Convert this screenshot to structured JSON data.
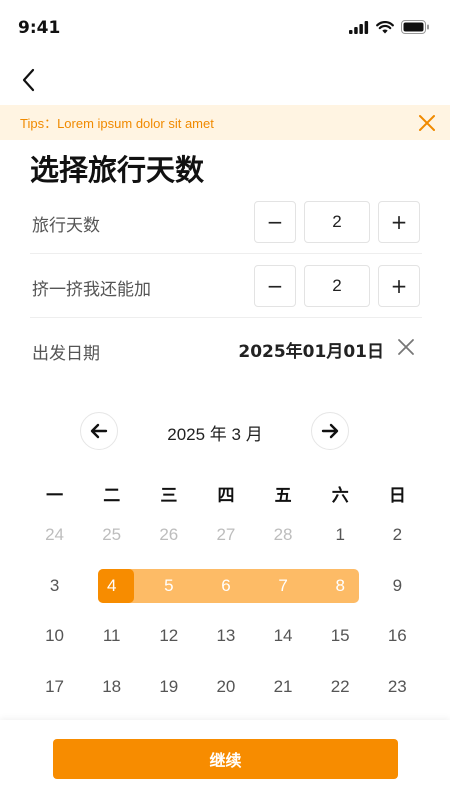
{
  "status_bar": {
    "time": "9:41",
    "icons": [
      "signal-icon",
      "wifi-icon",
      "battery-icon"
    ]
  },
  "nav": {
    "back_icon": "chevron-left-icon"
  },
  "tips": {
    "text": "Tips：Lorem ipsum dolor sit amet",
    "close_icon": "close-icon",
    "color": "#f08a00",
    "background": "#fff4e2"
  },
  "title": "选择旅行天数",
  "form": {
    "travel_days": {
      "label": "旅行天数",
      "value": "2",
      "minus": "−",
      "plus": "+"
    },
    "extra_days": {
      "label": "挤一挤我还能加",
      "value": "2",
      "minus": "−",
      "plus": "+"
    },
    "departure_date": {
      "label": "出发日期",
      "value": "2025年01月01日",
      "clear_icon": "close-icon"
    }
  },
  "calendar": {
    "title": "2025 年 3 月",
    "prev_icon": "arrow-left-icon",
    "next_icon": "arrow-right-icon",
    "weekdays": [
      "一",
      "二",
      "三",
      "四",
      "五",
      "六",
      "日"
    ],
    "weeks": [
      [
        {
          "d": "24",
          "m": true
        },
        {
          "d": "25",
          "m": true
        },
        {
          "d": "26",
          "m": true
        },
        {
          "d": "27",
          "m": true
        },
        {
          "d": "28",
          "m": true
        },
        {
          "d": "1"
        },
        {
          "d": "2"
        }
      ],
      [
        {
          "d": "3"
        },
        {
          "d": "4",
          "s": "start"
        },
        {
          "d": "5",
          "s": "range"
        },
        {
          "d": "6",
          "s": "range"
        },
        {
          "d": "7",
          "s": "range"
        },
        {
          "d": "8",
          "s": "range"
        },
        {
          "d": "9"
        }
      ],
      [
        {
          "d": "10"
        },
        {
          "d": "11"
        },
        {
          "d": "12"
        },
        {
          "d": "13"
        },
        {
          "d": "14"
        },
        {
          "d": "15"
        },
        {
          "d": "16"
        }
      ],
      [
        {
          "d": "17"
        },
        {
          "d": "18"
        },
        {
          "d": "19"
        },
        {
          "d": "20"
        },
        {
          "d": "21"
        },
        {
          "d": "22"
        },
        {
          "d": "23"
        }
      ]
    ],
    "range_color": "#fdbb66",
    "start_color": "#f78c00"
  },
  "footer": {
    "continue_label": "继续",
    "accent": "#f78c00"
  }
}
